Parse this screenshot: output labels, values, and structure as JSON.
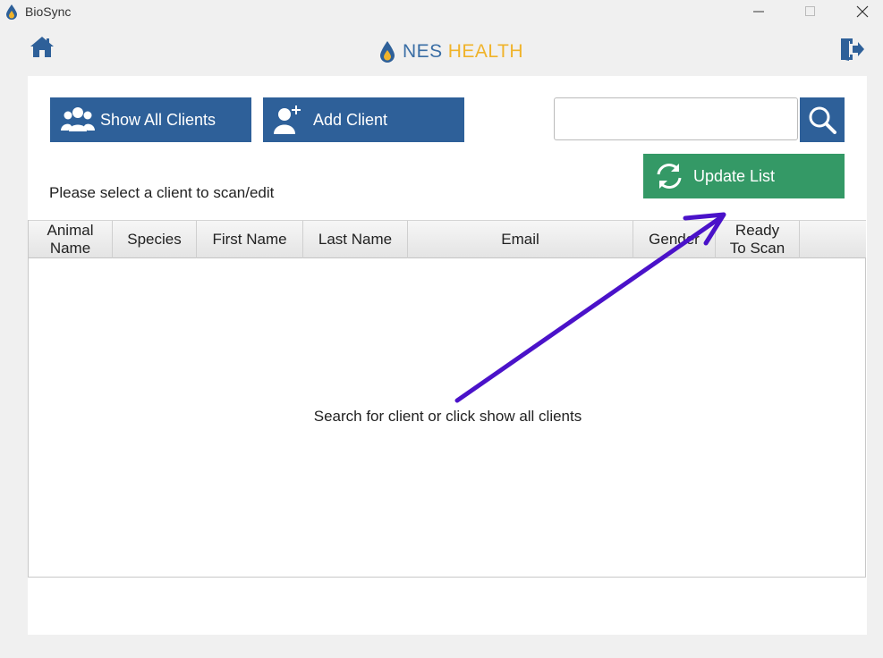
{
  "window": {
    "title": "BioSync"
  },
  "brand": {
    "part1": "NES",
    "part2": "HEALTH",
    "color_primary": "#3a6ea5",
    "color_accent": "#f0b32a"
  },
  "toolbar": {
    "show_all_label": "Show All Clients",
    "add_client_label": "Add Client",
    "update_list_label": "Update List",
    "search_value": "",
    "search_placeholder": ""
  },
  "instruction": "Please select a client to scan/edit",
  "table": {
    "columns": [
      {
        "label_line1": "Animal",
        "label_line2": "Name"
      },
      {
        "label_line1": "Species",
        "label_line2": ""
      },
      {
        "label_line1": "First Name",
        "label_line2": ""
      },
      {
        "label_line1": "Last Name",
        "label_line2": ""
      },
      {
        "label_line1": "Email",
        "label_line2": ""
      },
      {
        "label_line1": "Gender",
        "label_line2": ""
      },
      {
        "label_line1": "Ready",
        "label_line2": "To Scan"
      }
    ],
    "rows": [],
    "empty_message": "Search for client or click show all clients"
  },
  "icons": {
    "home": "home-icon",
    "exit": "exit-icon",
    "search": "search-icon",
    "users": "users-icon",
    "add_user": "add-user-icon",
    "refresh": "refresh-icon"
  },
  "colors": {
    "button_blue": "#2e6099",
    "button_green": "#349966",
    "annotation_arrow": "#4a12c9"
  }
}
